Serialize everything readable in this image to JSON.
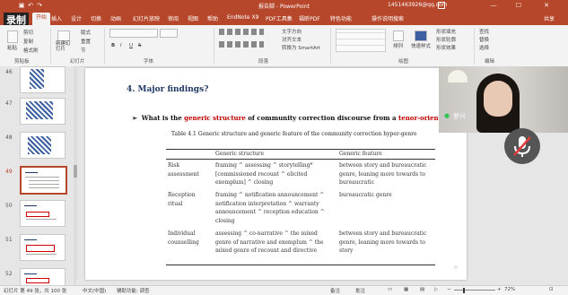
{
  "window": {
    "title": "报告脚 - PowerPoint",
    "account": "1451463926@qq.com",
    "recording_label": "录制"
  },
  "tabs": [
    "文件",
    "开始",
    "插入",
    "设计",
    "切换",
    "动画",
    "幻灯片放映",
    "审阅",
    "视图",
    "帮助",
    "EndNote X9",
    "PDF工具集",
    "福昕PDF",
    "特色功能"
  ],
  "active_tab": "开始",
  "tell_me": "操作说明搜索",
  "share": "共享",
  "ribbon": {
    "clipboard": {
      "paste": "粘贴",
      "cut": "剪切",
      "copy": "复制",
      "format_painter": "格式刷",
      "label": "剪贴板"
    },
    "slides": {
      "new_slide": "新建幻灯片",
      "layout": "版式",
      "reset": "重置",
      "section": "节",
      "label": "幻灯片"
    },
    "font": {
      "label": "字体",
      "bold": "B",
      "italic": "I",
      "underline": "U",
      "strike": "S"
    },
    "paragraph": {
      "label": "段落",
      "text_direction": "文字方向",
      "align_text": "对齐文本",
      "smartart": "转换为 SmartArt"
    },
    "drawing": {
      "arrange": "排列",
      "quick_styles": "快速样式",
      "shape_fill": "形状填充",
      "shape_outline": "形状轮廓",
      "shape_effects": "形状效果",
      "label": "绘图"
    },
    "editing": {
      "find": "查找",
      "replace": "替换",
      "select": "选择",
      "label": "编辑"
    }
  },
  "thumbnails": [
    {
      "num": "46",
      "selected": false
    },
    {
      "num": "47",
      "selected": false
    },
    {
      "num": "48",
      "selected": false
    },
    {
      "num": "49",
      "selected": true
    },
    {
      "num": "50",
      "selected": false
    },
    {
      "num": "51",
      "selected": false
    },
    {
      "num": "52",
      "selected": false
    }
  ],
  "slide": {
    "heading": "4. Major findings?",
    "question": {
      "bullet": "➢",
      "part1": "What is the ",
      "highlight1": "generic structure",
      "part2": " of community correction discourse from a ",
      "highlight2": "tenor-oriented",
      "part3": " pe"
    },
    "caption": "Table 4.1 Generic structure and generic feature of the community correction hyper-genre",
    "table": {
      "headers": [
        "Generic structure",
        "Generic feature"
      ],
      "rows": [
        {
          "label": [
            "Risk",
            "assessment"
          ],
          "structure": [
            "framing ^ assessing ^ storytelling*",
            "[commissioned recount ^ elicited",
            "exemplum] ^ closing"
          ],
          "feature": [
            "between story and bureaucratic",
            "genre, leaning more towards to",
            "bureaucratic"
          ]
        },
        {
          "label": [
            "Reception",
            "ritual"
          ],
          "structure": [
            "framing ^ notification announcement ^",
            "notification interpretation ^ warranty",
            "announcement ^ reception education ^",
            "closing"
          ],
          "feature": [
            "bureaucratic genre"
          ]
        },
        {
          "label": [
            "Individual",
            "counselling"
          ],
          "structure": [
            "assessing ^ co-narrative ^ the mixed",
            "genre of narrative and exemplum ^ the",
            "mixed genre of recount and directive"
          ],
          "feature": [
            "between story and bureaucratic",
            "genre, leaning more towards to",
            "story"
          ]
        }
      ]
    }
  },
  "video": {
    "speaker": "罗兴"
  },
  "statusbar": {
    "slide_info": "幻灯片 第 49 张，共 100 张",
    "language": "中文(中国)",
    "accessibility": "辅助功能: 调查",
    "notes": "备注",
    "comments": "批注",
    "zoom": "72%"
  },
  "colors": {
    "accent": "#b7472a",
    "heading": "#1f3864",
    "highlight": "#c00000"
  }
}
